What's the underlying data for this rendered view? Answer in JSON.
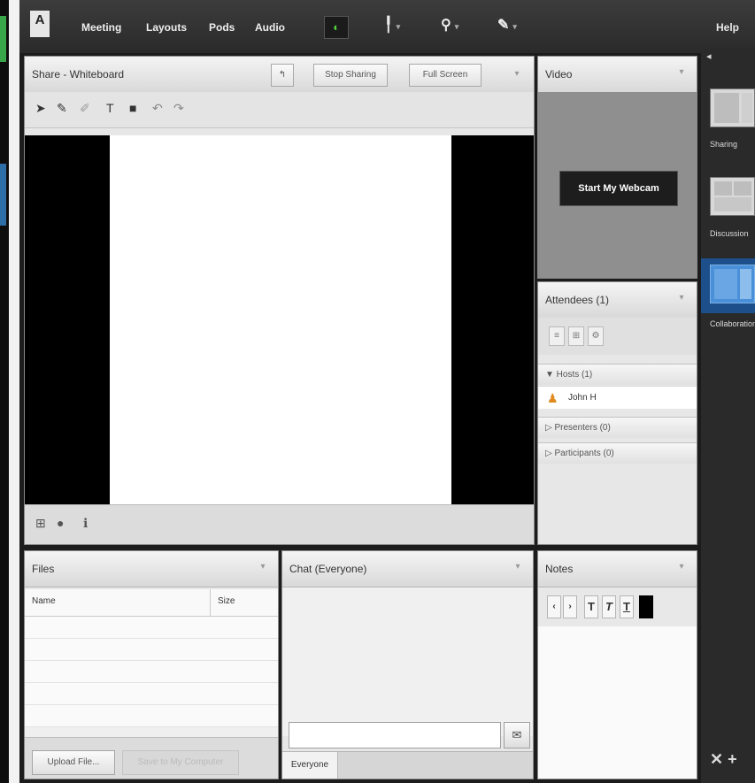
{
  "menubar": {
    "logo": "A",
    "items": [
      "Meeting",
      "Layouts",
      "Pods",
      "Audio"
    ],
    "status_icon": "◐",
    "toolbar_icons": [
      "raise-hand-icon",
      "people-icon",
      "pen-icon"
    ],
    "help": "Help"
  },
  "share": {
    "title": "Share - Whiteboard",
    "stop_sharing": "Stop Sharing",
    "full_screen": "Full Screen"
  },
  "video": {
    "title": "Video",
    "start_webcam": "Start My Webcam"
  },
  "attendees": {
    "title": "Attendees (1)",
    "hosts": "▼ Hosts (1)",
    "host_name": "John H",
    "presenters": "▷ Presenters (0)",
    "participants": "▷ Participants (0)"
  },
  "files": {
    "title": "Files",
    "col_name": "Name",
    "col_size": "Size",
    "upload": "Upload File...",
    "save": "Save to My Computer"
  },
  "chat": {
    "title": "Chat (Everyone)",
    "tab_everyone": "Everyone"
  },
  "notes": {
    "title": "Notes"
  },
  "layouts": {
    "items": [
      "Sharing",
      "Discussion",
      "Collaboration"
    ],
    "selected": "Collaboration"
  }
}
